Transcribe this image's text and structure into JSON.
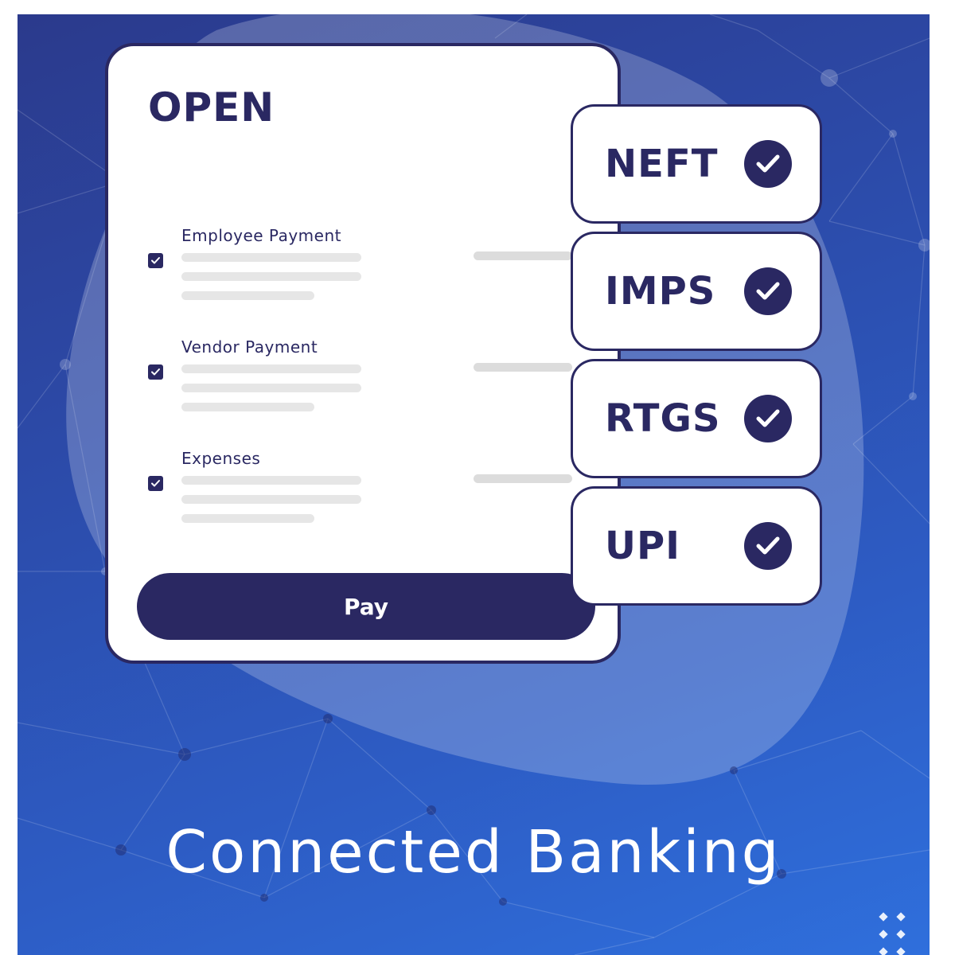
{
  "card": {
    "title": "OPEN",
    "items": [
      {
        "label": "Employee Payment",
        "checked": true
      },
      {
        "label": "Vendor Payment",
        "checked": true
      },
      {
        "label": "Expenses",
        "checked": true
      }
    ],
    "pay_button": "Pay"
  },
  "methods": [
    {
      "label": "NEFT",
      "status_icon": "check-circle-icon"
    },
    {
      "label": "IMPS",
      "status_icon": "check-circle-icon"
    },
    {
      "label": "RTGS",
      "status_icon": "check-circle-icon"
    },
    {
      "label": "UPI",
      "status_icon": "check-circle-icon"
    }
  ],
  "headline": "Connected Banking",
  "colors": {
    "navy": "#2a2862",
    "background_start": "#2b3a8c",
    "background_end": "#2f6fdc",
    "placeholder_line": "#e6e6e6"
  }
}
